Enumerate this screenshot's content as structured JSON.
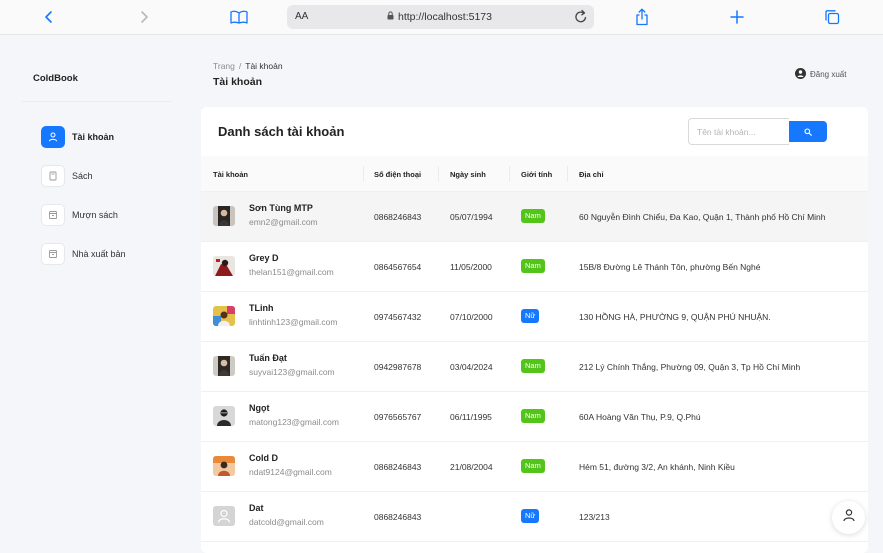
{
  "browser": {
    "text_size_label": "AA",
    "url": "http://localhost:5173",
    "icons": [
      "back-icon",
      "forward-icon",
      "bookmarks-icon",
      "lock-icon",
      "reload-icon",
      "share-icon",
      "new-tab-icon",
      "tabs-icon"
    ]
  },
  "sidebar": {
    "brand": "ColdBook",
    "items": [
      {
        "label": "Tài khoản",
        "icon": "user-icon",
        "active": true
      },
      {
        "label": "Sách",
        "icon": "book-icon",
        "active": false
      },
      {
        "label": "Mượn sách",
        "icon": "borrow-icon",
        "active": false
      },
      {
        "label": "Nhà xuất bản",
        "icon": "publisher-icon",
        "active": false
      }
    ]
  },
  "header": {
    "breadcrumb": [
      "Trang",
      "Tài khoản"
    ],
    "title": "Tài khoản",
    "logout_label": "Đăng xuất"
  },
  "card": {
    "title": "Danh sách tài khoản",
    "search_placeholder": "Tên tài khoản..."
  },
  "table": {
    "columns": [
      "Tài khoản",
      "Số điện thoại",
      "Ngày sinh",
      "Giới tính",
      "Địa chỉ"
    ],
    "rows": [
      {
        "name": "Sơn Tùng MTP",
        "email": "emn2@gmail.com",
        "phone": "0868246843",
        "dob": "05/07/1994",
        "gender": "Nam",
        "address": "60 Nguyễn Đình Chiểu, Đa Kao, Quận 1, Thành phố Hồ Chí Minh",
        "avatar": "photo"
      },
      {
        "name": "Grey D",
        "email": "thelan151@gmail.com",
        "phone": "0864567654",
        "dob": "11/05/2000",
        "gender": "Nam",
        "address": "15B/8 Đường Lê Thánh Tôn, phường Bến Nghé",
        "avatar": "photo"
      },
      {
        "name": "TLinh",
        "email": "linhtinh123@gmail.com",
        "phone": "0974567432",
        "dob": "07/10/2000",
        "gender": "Nữ",
        "address": "130 HỒNG HÀ, PHƯỜNG 9, QUẬN PHÚ NHUẬN.",
        "avatar": "photo"
      },
      {
        "name": "Tuấn Đạt",
        "email": "suyvai123@gmail.com",
        "phone": "0942987678",
        "dob": "03/04/2024",
        "gender": "Nam",
        "address": "212 Lý Chính Thắng, Phường 09, Quận 3, Tp Hồ Chí Minh",
        "avatar": "photo"
      },
      {
        "name": "Ngọt",
        "email": "matong123@gmail.com",
        "phone": "0976565767",
        "dob": "06/11/1995",
        "gender": "Nam",
        "address": "60A Hoàng Văn Thụ, P.9, Q.Phú",
        "avatar": "photo"
      },
      {
        "name": "Cold D",
        "email": "ndat9124@gmail.com",
        "phone": "0868246843",
        "dob": "21/08/2004",
        "gender": "Nam",
        "address": "Hẻm 51, đường 3/2, An khánh, Ninh Kiều",
        "avatar": "photo"
      },
      {
        "name": "Dat",
        "email": "datcold@gmail.com",
        "phone": "0868246843",
        "dob": "",
        "gender": "Nữ",
        "address": "123/213",
        "avatar": "default"
      }
    ]
  },
  "colors": {
    "accent": "#1677ff",
    "male_tag": "#52c41a",
    "female_tag": "#1677ff"
  }
}
